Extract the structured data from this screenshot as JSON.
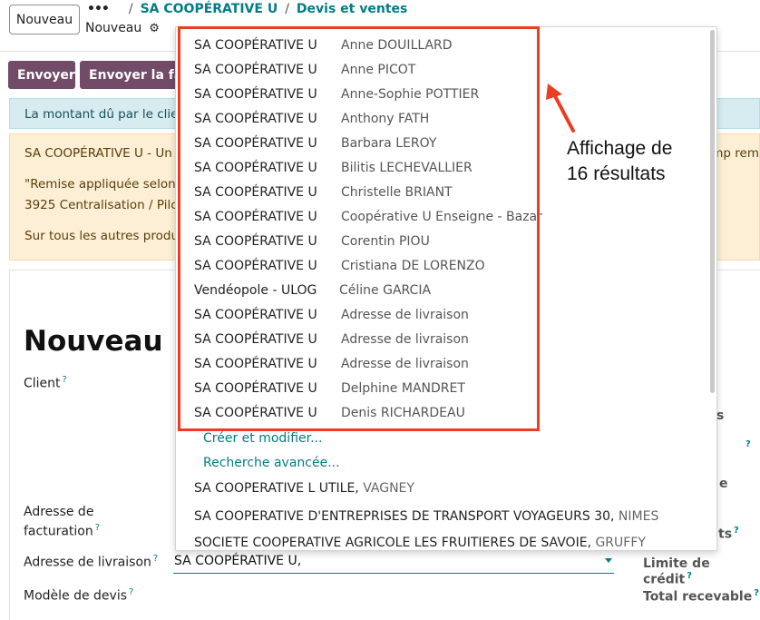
{
  "control_panel": {
    "new_button": "Nouveau",
    "breadcrumb_dots": "•••",
    "breadcrumb_sep": "/",
    "breadcrumb_partner": "SA COOPÉRATIVE U",
    "breadcrumb_section": "Devis et ventes",
    "current_record": "Nouveau",
    "gear_glyph": "⚙"
  },
  "actions": {
    "send": "Envoyer",
    "send_invoice": "Envoyer la fact"
  },
  "alerts": {
    "info": "La montant dû par le clier",
    "warn_line1": "SA COOPÉRATIVE U - Un",
    "warn_line1_tail": "mp rem",
    "warn_line2": "\"Remise appliquée selon",
    "warn_line3": "3925 Centralisation / Pilc",
    "warn_line4": "Sur tous les autres produ"
  },
  "form": {
    "title": "Nouveau",
    "client_label": "Client",
    "billing_label_1": "Adresse de",
    "billing_label_2": "facturation",
    "shipping_label": "Adresse de livraison",
    "shipping_value": "SA COOPÉRATIVE U,",
    "quote_template_label": "Modèle de devis",
    "help_mark": "?",
    "right_labels": {
      "r1": "s",
      "r3": "e",
      "r4": "ts",
      "credit_limit": "Limite de crédit",
      "total_receivable": "Total recevable"
    }
  },
  "dropdown": {
    "results": [
      {
        "company": "SA COOPÉRATIVE U",
        "contact": "Anne DOUILLARD"
      },
      {
        "company": "SA COOPÉRATIVE U",
        "contact": "Anne PICOT"
      },
      {
        "company": "SA COOPÉRATIVE U",
        "contact": "Anne-Sophie POTTIER"
      },
      {
        "company": "SA COOPÉRATIVE U",
        "contact": "Anthony FATH"
      },
      {
        "company": "SA COOPÉRATIVE U",
        "contact": "Barbara LEROY"
      },
      {
        "company": "SA COOPÉRATIVE U",
        "contact": "Bilitis LECHEVALLIER"
      },
      {
        "company": "SA COOPÉRATIVE U",
        "contact": "Christelle BRIANT"
      },
      {
        "company": "SA COOPÉRATIVE U",
        "contact": "Coopérative U Enseigne - Bazar"
      },
      {
        "company": "SA COOPÉRATIVE U",
        "contact": "Corentin PIOU"
      },
      {
        "company": "SA COOPÉRATIVE U",
        "contact": "Cristiana DE LORENZO"
      },
      {
        "company": "Vendéopole - ULOG",
        "contact": "Céline GARCIA"
      },
      {
        "company": "SA COOPÉRATIVE U",
        "contact": "Adresse de livraison"
      },
      {
        "company": "SA COOPÉRATIVE U",
        "contact": "Adresse de livraison"
      },
      {
        "company": "SA COOPÉRATIVE U",
        "contact": "Adresse de livraison"
      },
      {
        "company": "SA COOPÉRATIVE U",
        "contact": "Delphine MANDRET"
      },
      {
        "company": "SA COOPÉRATIVE U",
        "contact": "Denis RICHARDEAU"
      }
    ],
    "create_edit": "Créer et modifier...",
    "advanced_search": "Recherche avancée...",
    "other_results": [
      {
        "name": "SA COOPERATIVE L UTILE, ",
        "city": "VAGNEY"
      },
      {
        "name": "SA COOPERATIVE D'ENTREPRISES DE TRANSPORT VOYAGEURS 30, ",
        "city": "NIMES"
      },
      {
        "name": "SOCIETE COOPERATIVE AGRICOLE LES FRUITIERES DE SAVOIE, ",
        "city": "GRUFFY"
      }
    ]
  },
  "annotation": {
    "line1": "Affichage de",
    "line2": "16 résultats",
    "box_color": "#ea3d22"
  }
}
